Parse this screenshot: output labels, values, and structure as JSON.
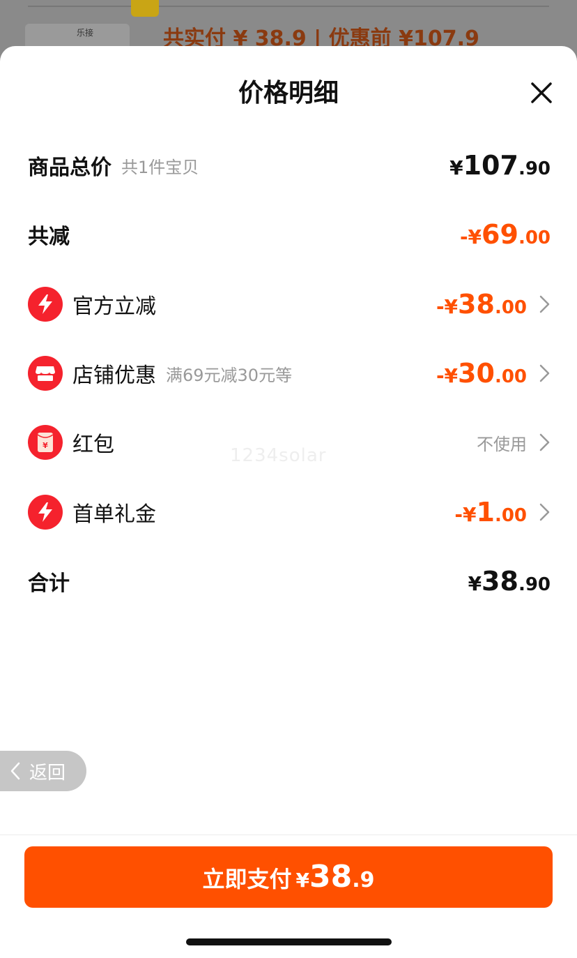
{
  "background": {
    "thumb_text": "乐接",
    "price_text": "共实付 ¥ 38.9 | 优惠前 ¥107.9"
  },
  "sheet": {
    "title": "价格明细"
  },
  "rows": {
    "subtotal": {
      "label": "商品总价",
      "sub": "共1件宝贝",
      "yen": "¥",
      "int": "107",
      "dec": ".90"
    },
    "discount_total": {
      "label": "共减",
      "yen": "-¥",
      "int": "69",
      "dec": ".00"
    },
    "official": {
      "label": "官方立减",
      "yen": "-¥",
      "int": "38",
      "dec": ".00"
    },
    "shop": {
      "label": "店铺优惠",
      "sub": "满69元减30元等",
      "yen": "-¥",
      "int": "30",
      "dec": ".00"
    },
    "redpacket": {
      "label": "红包",
      "value": "不使用"
    },
    "first_order": {
      "label": "首单礼金",
      "yen": "-¥",
      "int": "1",
      "dec": ".00"
    },
    "total": {
      "label": "合计",
      "yen": "¥",
      "int": "38",
      "dec": ".90"
    }
  },
  "watermark": "1234solar",
  "back_button": {
    "label": "返回"
  },
  "pay_button": {
    "label": "立即支付",
    "yen": "¥",
    "int": "38",
    "dec": ".9"
  },
  "colors": {
    "accent": "#ff5000",
    "icon_red": "#f5222d",
    "muted": "#999999"
  },
  "icons": {
    "official": "lightning-icon",
    "shop": "store-icon",
    "redpacket": "red-envelope-icon",
    "first_order": "lightning-icon",
    "close": "close-icon",
    "chevron": "chevron-right-icon",
    "back": "chevron-left-icon"
  }
}
